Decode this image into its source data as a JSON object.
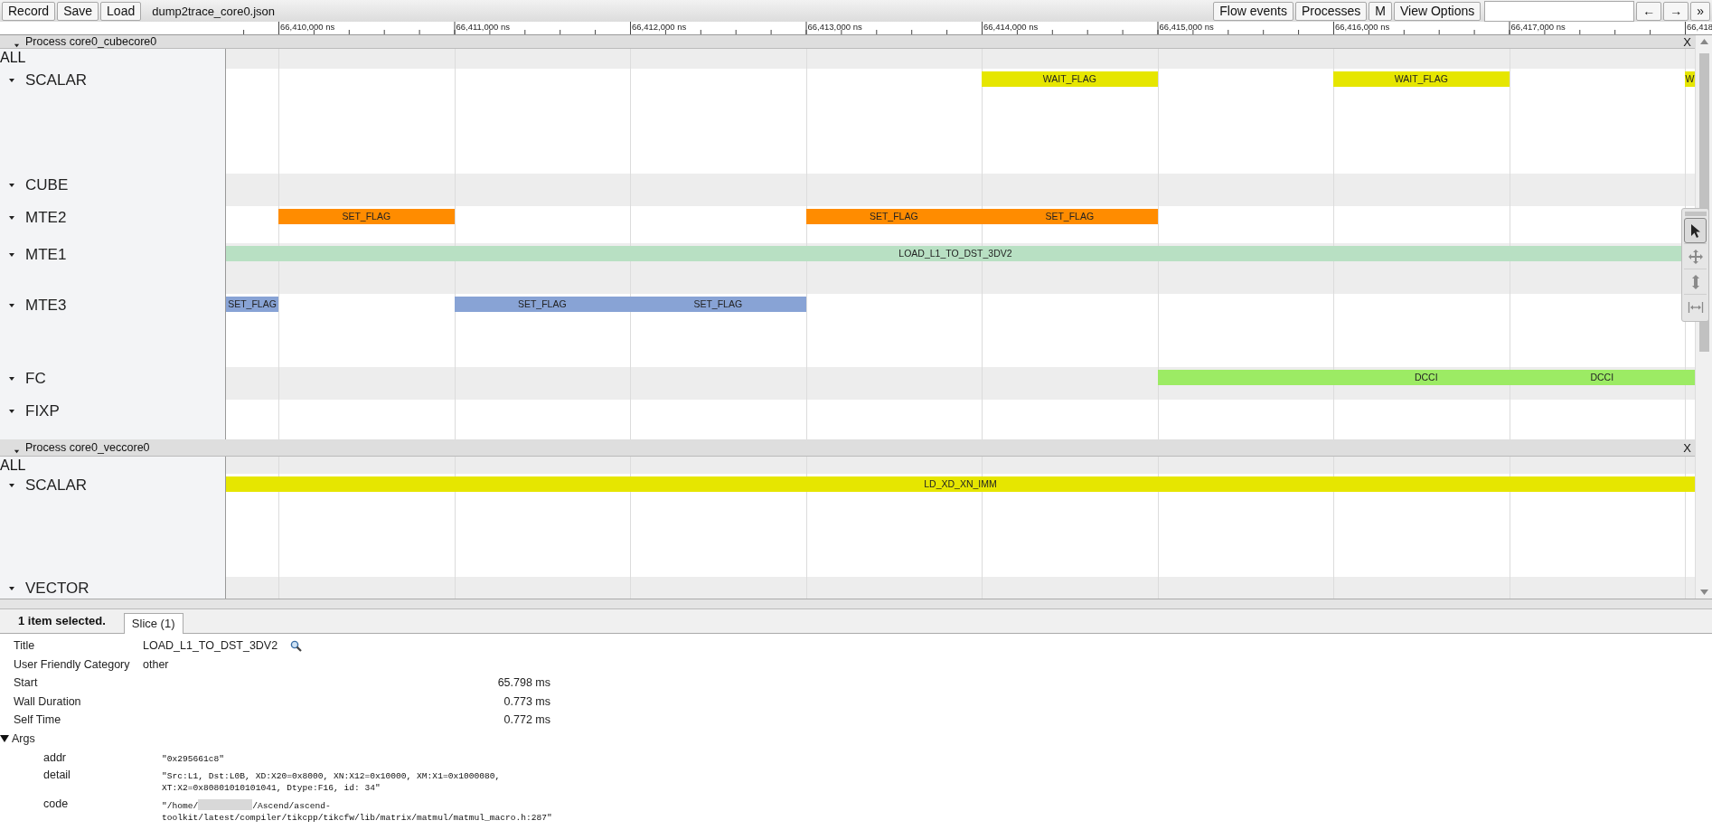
{
  "toolbar": {
    "buttons": [
      "Record",
      "Save",
      "Load"
    ],
    "filename": "dump2trace_core0.json",
    "right_buttons": [
      "Flow events",
      "Processes",
      "M",
      "View Options"
    ],
    "nav_buttons": [
      "←",
      "→",
      "»"
    ]
  },
  "ruler": {
    "ticks": [
      "66,410,000 ns",
      "66,411,000 ns",
      "66,412,000 ns",
      "66,413,000 ns",
      "66,414,000 ns",
      "66,415,000 ns",
      "66,416,000 ns",
      "66,417,000 ns",
      "66,418"
    ]
  },
  "processes": [
    {
      "title": "Process core0_cubecore0",
      "close": "X",
      "all_label": "ALL",
      "tracks": [
        {
          "name": "SCALAR",
          "slices": [
            {
              "label": "WAIT_FLAG",
              "color": "#e6e600"
            },
            {
              "label": "WAIT_FLAG",
              "color": "#e6e600"
            },
            {
              "label": "W",
              "color": "#e6e600"
            }
          ]
        },
        {
          "name": "CUBE"
        },
        {
          "name": "MTE2",
          "slices": [
            {
              "label": "SET_FLAG",
              "color": "#ff8c00"
            },
            {
              "label": "SET_FLAG",
              "color": "#ff8c00"
            },
            {
              "label": "SET_FLAG",
              "color": "#ff8c00"
            }
          ]
        },
        {
          "name": "MTE1",
          "slices": [
            {
              "label": "LOAD_L1_TO_DST_3DV2",
              "color": "#b8e0c3"
            }
          ]
        },
        {
          "name": "MTE3",
          "slices": [
            {
              "label": "SET_FLAG",
              "color": "#88a3d5"
            },
            {
              "label": "SET_FLAG",
              "color": "#88a3d5"
            },
            {
              "label": "SET_FLAG",
              "color": "#88a3d5"
            }
          ]
        },
        {
          "name": "FC",
          "slices": [
            {
              "label": "DCCI",
              "color": "#9ceb64"
            },
            {
              "label": "DCCI",
              "color": "#9ceb64"
            }
          ]
        },
        {
          "name": "FIXP"
        }
      ]
    },
    {
      "title": "Process core0_veccore0",
      "close": "X",
      "all_label": "ALL",
      "tracks": [
        {
          "name": "SCALAR",
          "slices": [
            {
              "label": "LD_XD_XN_IMM",
              "color": "#e6e600"
            }
          ]
        },
        {
          "name": "VECTOR"
        }
      ]
    }
  ],
  "tool_palette": {
    "tools": [
      {
        "kind": "select",
        "selected": true
      },
      {
        "kind": "pan",
        "selected": false
      },
      {
        "kind": "zoom",
        "selected": false
      },
      {
        "kind": "timing",
        "selected": false
      }
    ]
  },
  "details": {
    "summary": "1 item selected.",
    "tabs": [
      {
        "label": "Slice (1)",
        "selected": true
      }
    ],
    "rows": [
      {
        "label": "Title",
        "value": "LOAD_L1_TO_DST_3DV2",
        "kind": "title"
      },
      {
        "label": "User Friendly Category",
        "value": "other",
        "kind": "text"
      },
      {
        "label": "Start",
        "value": "65.798 ms",
        "kind": "time"
      },
      {
        "label": "Wall Duration",
        "value": "0.773 ms",
        "kind": "time"
      },
      {
        "label": "Self Time",
        "value": "0.772 ms",
        "kind": "time"
      }
    ],
    "args": {
      "label": "Args",
      "expanded": true,
      "items": [
        {
          "key": "addr",
          "value": "\"0x295661c8\""
        },
        {
          "key": "detail",
          "value": "\"Src:L1, Dst:L0B, XD:X20=0x8000, XN:X12=0x10000, XM:X1=0x1000080, XT:X2=0x80801010101041, Dtype:F16, id: 34\""
        },
        {
          "key": "code",
          "value": "\"/home/",
          "redacted": true,
          "value_after": "/Ascend/ascend-toolkit/latest/compiler/tikcpp/tikcfw/lib/matrix/matmul/matmul_macro.h:287\""
        }
      ]
    }
  }
}
